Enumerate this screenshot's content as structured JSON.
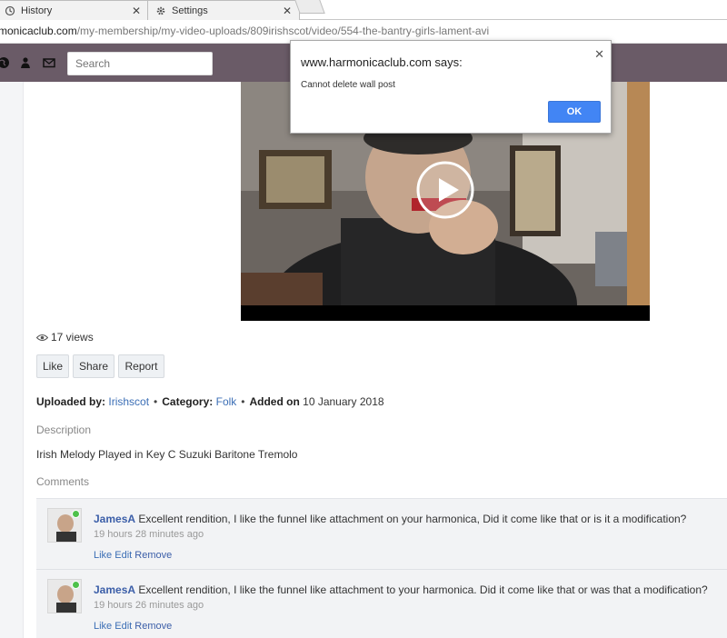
{
  "browser": {
    "tabs": [
      {
        "title": "History",
        "icon": "history-icon"
      },
      {
        "title": "Settings",
        "icon": "gear-icon"
      }
    ],
    "url": {
      "host": "monicaclub.com",
      "path": "/my-membership/my-video-uploads/809irishscot/video/554-the-bantry-girls-lament-avi"
    }
  },
  "header": {
    "icons": [
      "globe-icon",
      "person-icon",
      "mail-icon"
    ],
    "search": {
      "placeholder": "Search"
    }
  },
  "video": {
    "views_text": "17 views",
    "actions": {
      "like": "Like",
      "share": "Share",
      "report": "Report"
    },
    "meta": {
      "uploaded_by_label": "Uploaded by:",
      "uploader": "Irishscot",
      "category_label": "Category:",
      "category": "Folk",
      "added_label": "Added on",
      "date": "10 January 2018"
    },
    "description_label": "Description",
    "description": "Irish Melody Played in Key C Suzuki Baritone Tremolo"
  },
  "comments": {
    "label": "Comments",
    "items": [
      {
        "author": "JamesA",
        "text": "Excellent rendition, I like the funnel like attachment on your harmonica, Did it come like that or is it a modification?",
        "time": "19 hours 28 minutes ago",
        "actions": [
          "Like",
          "Edit",
          "Remove"
        ]
      },
      {
        "author": "JamesA",
        "text": "Excellent rendition, I like the funnel like attachment to your harmonica. Did it come like that or was that a modification?",
        "time": "19 hours 26 minutes ago",
        "actions": [
          "Like",
          "Edit",
          "Remove"
        ]
      }
    ]
  },
  "dialog": {
    "title": "www.harmonicaclub.com says:",
    "message": "Cannot delete wall post",
    "ok": "OK"
  },
  "colors": {
    "header_bar": "#6a5b67",
    "link": "#3b6eb5",
    "ok_button": "#4285f4",
    "online_badge": "#4ec14a"
  }
}
